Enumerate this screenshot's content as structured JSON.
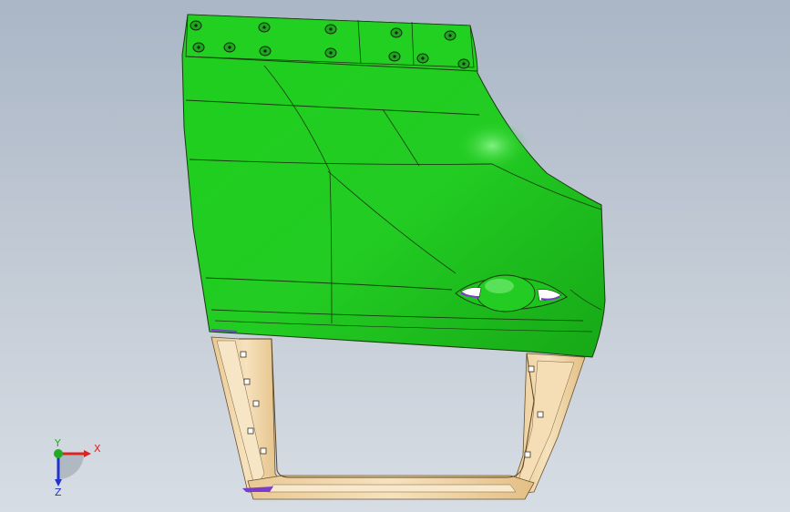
{
  "viewport": {
    "background_top": "#aab6c6",
    "background_bottom": "#d7dde4"
  },
  "model": {
    "outer_panel_color": "#22cc22",
    "inner_frame_color": "#f2d9ae",
    "edge_color": "#1b3a10"
  },
  "triad": {
    "x_label": "X",
    "y_label": "Y",
    "z_label": "Z",
    "x_color": "#dd2222",
    "y_color": "#22aa22",
    "z_color": "#2233cc"
  }
}
